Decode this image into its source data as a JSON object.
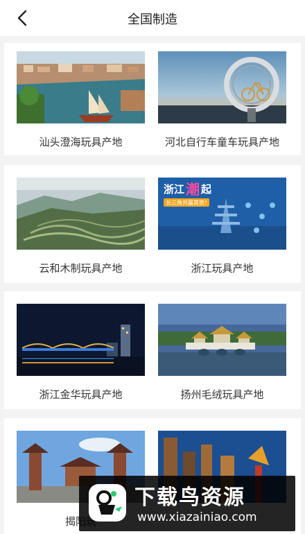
{
  "nav": {
    "title": "全国制造",
    "back_icon": "chevron-left-icon"
  },
  "items": [
    {
      "label": "汕头澄海玩具产地"
    },
    {
      "label": "河北自行车童车玩具产地"
    },
    {
      "label": "云和木制玩具产地"
    },
    {
      "label": "浙江玩具产地"
    },
    {
      "label": "浙江金华玩具产地"
    },
    {
      "label": "扬州毛绒玩具产地"
    },
    {
      "label": "揭阳玩"
    }
  ],
  "poster": {
    "brand": "浙江",
    "brand2": "潮",
    "brand3": "起",
    "slogan": "长三角共赢其势！"
  },
  "watermark": {
    "title": "下载鸟资源",
    "url": "www.xiazainiao.com"
  }
}
